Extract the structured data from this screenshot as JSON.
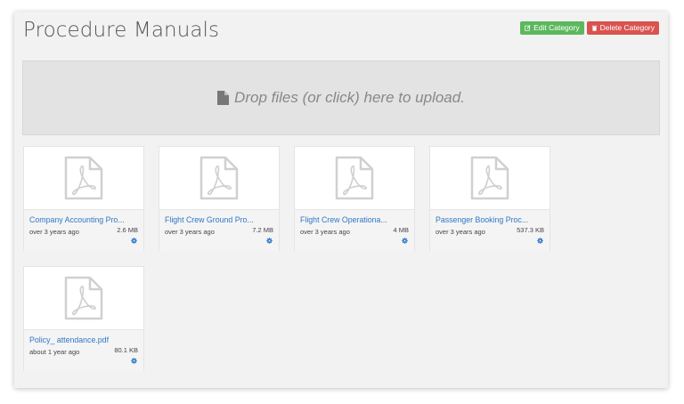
{
  "page": {
    "title": "Procedure Manuals"
  },
  "actions": {
    "edit_label": "Edit Category",
    "delete_label": "Delete Category"
  },
  "dropzone": {
    "label": "Drop files (or click) here to upload."
  },
  "files": [
    {
      "name": "Company Accounting Pro...",
      "age": "over 3 years ago",
      "size": "2.6 MB"
    },
    {
      "name": "Flight Crew Ground Pro...",
      "age": "over 3 years ago",
      "size": "7.2 MB"
    },
    {
      "name": "Flight Crew Operationa...",
      "age": "over 3 years ago",
      "size": "4 MB"
    },
    {
      "name": "Passenger Booking Proc...",
      "age": "over 3 years ago",
      "size": "537.3 KB"
    },
    {
      "name": "Policy_ attendance.pdf",
      "age": "about 1 year ago",
      "size": "80.1 KB"
    }
  ],
  "colors": {
    "edit": "#5cb85c",
    "delete": "#d9534f",
    "link": "#2f77c7"
  },
  "icons": {
    "file_thumb": "pdf-file-icon",
    "upload": "file-icon",
    "file_action": "gear-icon"
  }
}
